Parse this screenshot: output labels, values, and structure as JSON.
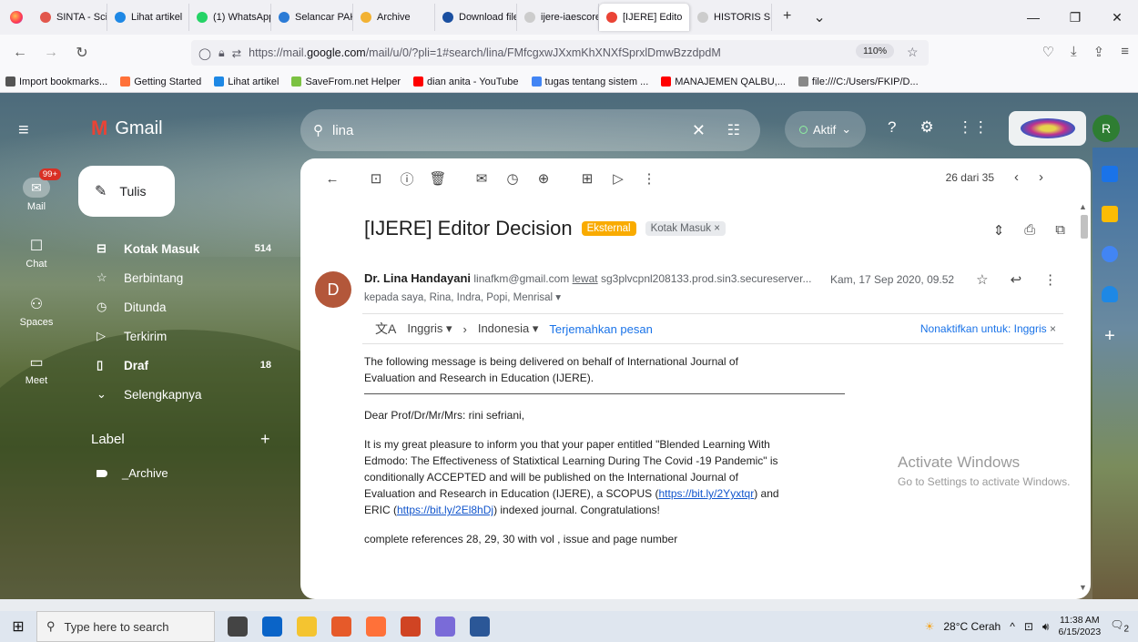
{
  "browser": {
    "tabs": [
      {
        "label": "SINTA - Science ar",
        "color": "#e2574c"
      },
      {
        "label": "Lihat artikel",
        "color": "#1e88e5"
      },
      {
        "label": "(1) WhatsApp",
        "color": "#25d366"
      },
      {
        "label": "Selancar PAK -",
        "color": "#2b7bd6"
      },
      {
        "label": "Archive",
        "color": "#f2b233"
      },
      {
        "label": "Download file",
        "color": "#1a4fa0"
      },
      {
        "label": "ijere-iaescore-con",
        "color": "#cccccc"
      },
      {
        "label": "[IJERE] Edito",
        "color": "#ea4335",
        "active": true
      },
      {
        "label": "HISTORIS SUBMISS",
        "color": "#cccccc"
      }
    ],
    "url_prefix": "https://mail.",
    "url_domain": "google.com",
    "url_rest": "/mail/u/0/?pli=1#search/lina/FMfcgxwJXxmKhXNXfSprxlDmwBzzdpdM",
    "zoom": "110%",
    "bookmarks": [
      {
        "label": "Import bookmarks...",
        "color": "#555555"
      },
      {
        "label": "Getting Started",
        "color": "#ff7139"
      },
      {
        "label": "Lihat artikel",
        "color": "#1e88e5"
      },
      {
        "label": "SaveFrom.net Helper",
        "color": "#7cc242"
      },
      {
        "label": "dian anita - YouTube",
        "color": "#ff0000"
      },
      {
        "label": "tugas tentang sistem ...",
        "color": "#4285f4"
      },
      {
        "label": "MANAJEMEN QALBU,...",
        "color": "#ff0000"
      },
      {
        "label": "file:///C:/Users/FKIP/D...",
        "color": "#888888"
      }
    ]
  },
  "gmail": {
    "app_name": "Gmail",
    "search_query": "lina",
    "status": "Aktif",
    "avatar_letter": "R",
    "rail": [
      {
        "label": "Mail",
        "icon": "mail-icon",
        "glyph": "✉",
        "badge": "99+"
      },
      {
        "label": "Chat",
        "icon": "chat-icon",
        "glyph": "☐"
      },
      {
        "label": "Spaces",
        "icon": "spaces-icon",
        "glyph": "⚇"
      },
      {
        "label": "Meet",
        "icon": "meet-icon",
        "glyph": "▭"
      }
    ],
    "compose_label": "Tulis",
    "nav": [
      {
        "label": "Kotak Masuk",
        "icon": "inbox-icon",
        "glyph": "⊟",
        "count": "514",
        "bold": true
      },
      {
        "label": "Berbintang",
        "icon": "star-icon",
        "glyph": "☆",
        "count": ""
      },
      {
        "label": "Ditunda",
        "icon": "snooze-icon",
        "glyph": "◷",
        "count": ""
      },
      {
        "label": "Terkirim",
        "icon": "sent-icon",
        "glyph": "▷",
        "count": ""
      },
      {
        "label": "Draf",
        "icon": "draft-icon",
        "glyph": "▯",
        "count": "18",
        "bold": true
      },
      {
        "label": "Selengkapnya",
        "icon": "chevron-down-icon",
        "glyph": "⌄",
        "count": ""
      }
    ],
    "label_heading": "Label",
    "labels": [
      "_Archive"
    ]
  },
  "email": {
    "position": "26 dari 35",
    "subject": "[IJERE] Editor Decision",
    "tag_external": "Eksternal",
    "tag_inbox": "Kotak Masuk ×",
    "sender_initial": "D",
    "sender_name": "Dr. Lina Handayani",
    "sender_email": "linafkm@gmail.com",
    "via_label": "lewat",
    "via_server": "sg3plvcpnl208133.prod.sin3.secureserver...",
    "date": "Kam, 17 Sep 2020, 09.52",
    "recipients": "kepada saya, Rina, Indra, Popi, Menrisal ▾",
    "translate_from": "Inggris ▾",
    "translate_arrow": "›",
    "translate_to": "Indonesia ▾",
    "translate_link": "Terjemahkan pesan",
    "translate_off": "Nonaktifkan untuk: Inggris",
    "body_intro": "The following message is being delivered on behalf of International Journal of Evaluation and Research in Education (IJERE).",
    "body_greeting": "Dear Prof/Dr/Mr/Mrs: rini sefriani,",
    "body_p1_a": "It is my great pleasure to inform you that your paper entitled \"Blended Learning With Edmodo: The Effectiveness of Statixtical Learning During The Covid -19 Pandemic\" is conditionally ACCEPTED and will be published on the International Journal of Evaluation and Research in Education (IJERE), a SCOPUS (",
    "link1": "https://bit.ly/2Yyxtqr",
    "body_p1_b": ") and ERIC (",
    "link2": "https://bit.ly/2El8hDj",
    "body_p1_c": ") indexed journal. Congratulations!",
    "body_p2": "complete references 28, 29, 30 with vol , issue and page number"
  },
  "windows": {
    "activate_title": "Activate Windows",
    "activate_sub": "Go to Settings to activate Windows.",
    "search_placeholder": "Type here to search",
    "weather": "28°C Cerah",
    "time": "11:38 AM",
    "date": "6/15/2023",
    "notif_count": "2",
    "taskbar_apps": [
      {
        "name": "task-view-icon",
        "color": "#444444"
      },
      {
        "name": "mail-app-icon",
        "color": "#0a64c8"
      },
      {
        "name": "file-explorer-icon",
        "color": "#f4c430"
      },
      {
        "name": "app-g-icon",
        "color": "#e65a2a"
      },
      {
        "name": "firefox-icon",
        "color": "#ff7139"
      },
      {
        "name": "powerpoint-icon",
        "color": "#d04423"
      },
      {
        "name": "app-swirl-icon",
        "color": "#7a6bd8"
      },
      {
        "name": "word-icon",
        "color": "#2b5797"
      }
    ]
  }
}
